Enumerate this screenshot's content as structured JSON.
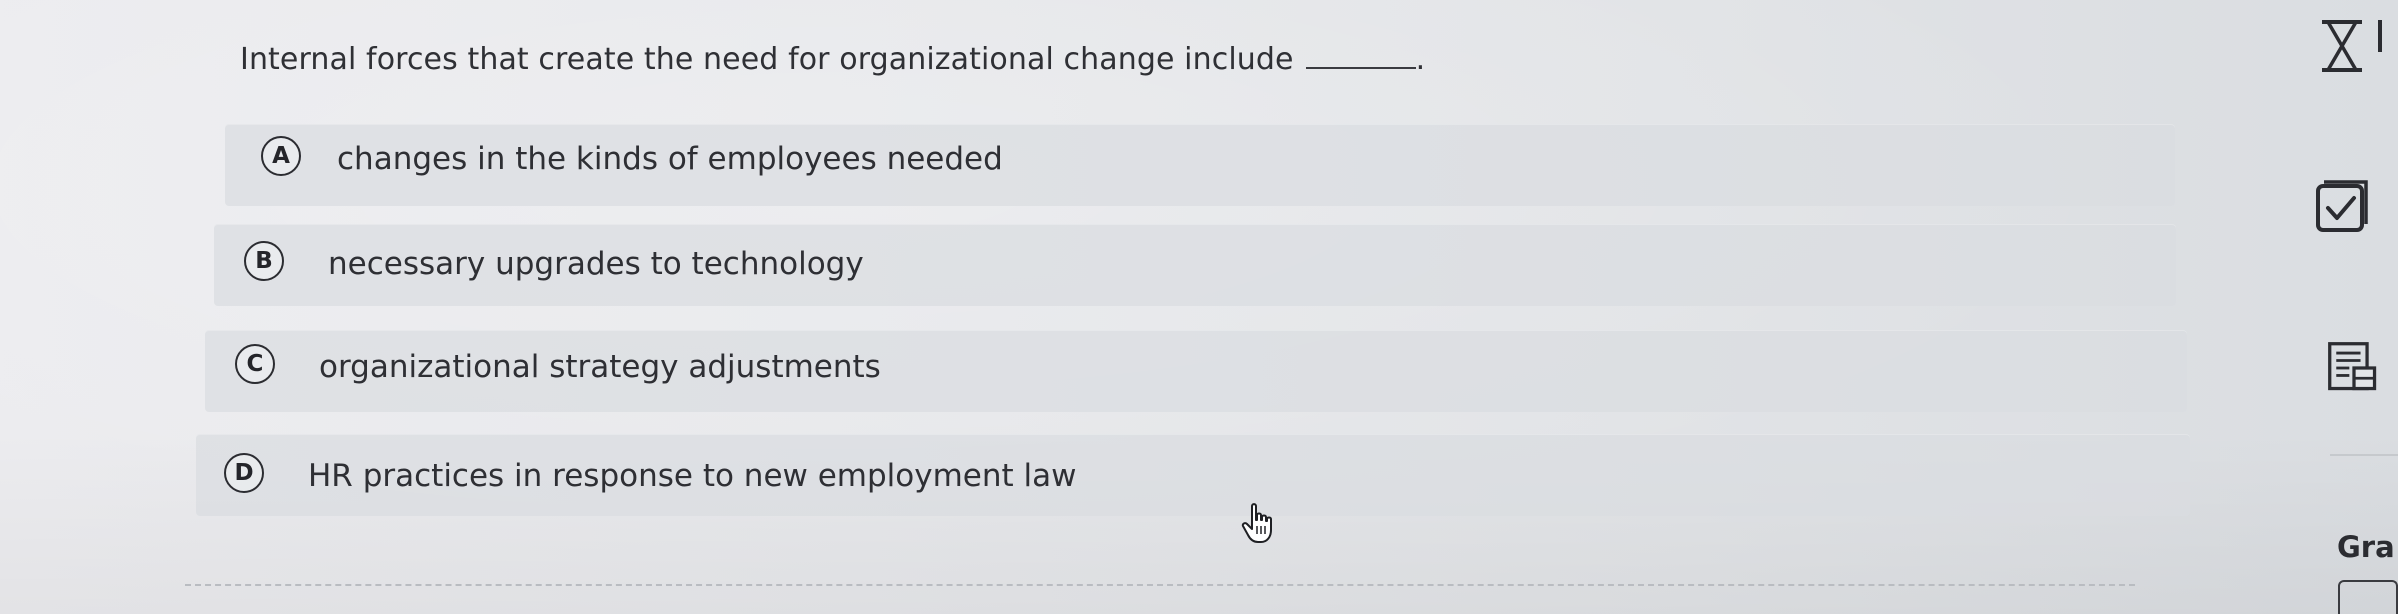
{
  "question": {
    "text": "Internal forces that create the need for organizational change include",
    "end_punct": "."
  },
  "options": [
    {
      "letter": "A",
      "text": "changes in the kinds of employees needed"
    },
    {
      "letter": "B",
      "text": "necessary upgrades to technology"
    },
    {
      "letter": "C",
      "text": "organizational strategy adjustments"
    },
    {
      "letter": "D",
      "text": "HR practices in response to new employment law"
    }
  ],
  "sidebar": {
    "timer_icon": "hourglass-icon",
    "check_icon": "checkbox-icon",
    "calc_icon": "calculator-icon",
    "grade_label": "Gra"
  },
  "cursor_icon": "hand-pointer-icon",
  "colors": {
    "text": "#2f3035",
    "option_bg": "#dadce0",
    "background": "#e7e8eb"
  }
}
